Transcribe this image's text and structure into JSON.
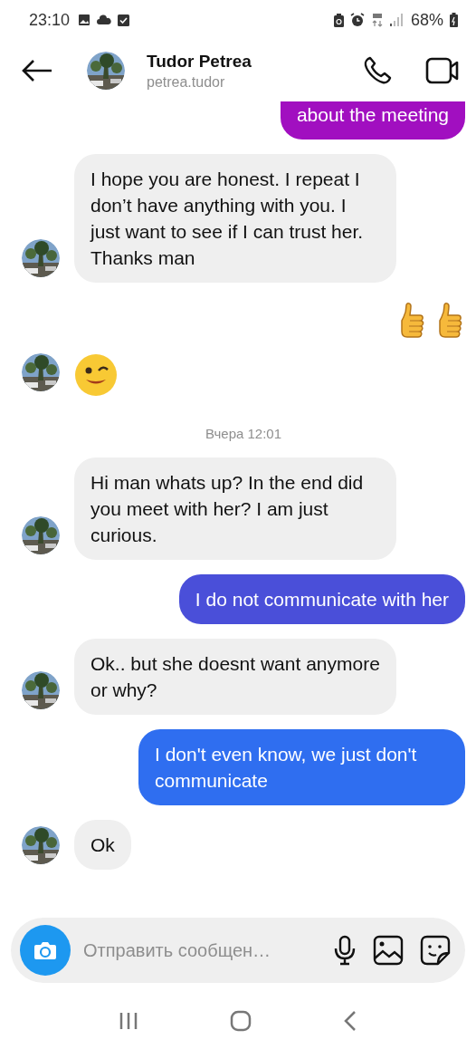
{
  "status_bar": {
    "time": "23:10",
    "battery": "68%"
  },
  "header": {
    "name": "Tudor Petrea",
    "username": "petrea.tudor"
  },
  "messages": [
    {
      "kind": "text",
      "outgoing": true,
      "text": "about the meeting",
      "color": "#a10fc0"
    },
    {
      "kind": "text",
      "outgoing": false,
      "text": "I hope you are honest. I repeat I don’t have anything with you. I just want to see if I can trust her. Thanks man"
    },
    {
      "kind": "like",
      "outgoing": true
    },
    {
      "kind": "wink",
      "outgoing": false
    },
    {
      "kind": "time",
      "text": "Вчера 12:01"
    },
    {
      "kind": "text",
      "outgoing": false,
      "text": "Hi man whats up? In the end did you meet with her? I am just curious."
    },
    {
      "kind": "text",
      "outgoing": true,
      "text": "I do not communicate with her",
      "color": "#4a4fd9"
    },
    {
      "kind": "text",
      "outgoing": false,
      "text": "Ok.. but she doesnt want anymore or why?"
    },
    {
      "kind": "text",
      "outgoing": true,
      "text": "I don't even know, we just don't communicate",
      "color": "#2f6ef0"
    },
    {
      "kind": "text",
      "outgoing": false,
      "text": "Ok"
    }
  ],
  "composer": {
    "placeholder": "Отправить сообщен…"
  }
}
